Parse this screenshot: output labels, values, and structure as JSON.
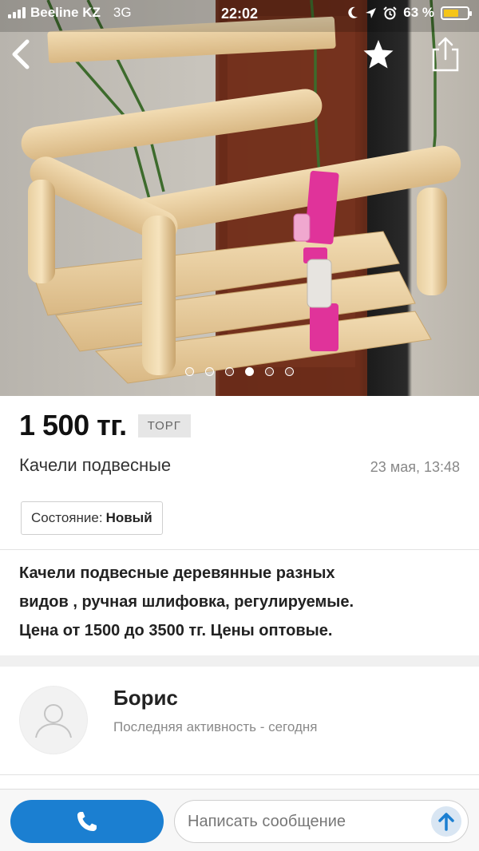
{
  "status_bar": {
    "carrier": "Beeline KZ",
    "network": "3G",
    "time": "22:02",
    "battery_text": "63 %",
    "battery_level": 0.63,
    "battery_color": "#f5c518"
  },
  "nav": {
    "back_icon": "chevron-left-icon",
    "favorite_icon": "star-icon",
    "share_icon": "share-icon"
  },
  "gallery": {
    "photo_count": 6,
    "active_index": 3
  },
  "listing": {
    "price": "1 500 тг.",
    "negotiable_badge": "ТОРГ",
    "title": "Качели подвесные",
    "date": "23 мая, 13:48",
    "condition_label": "Состояние:",
    "condition_value": "Новый",
    "description": "Качели подвесные деревянные   разных\nвидов , ручная шлифовка, регулируемые.\nЦена от 1500 до 3500 тг.  Цены оптовые."
  },
  "seller": {
    "name": "Борис",
    "activity": "Последняя активность - сегодня"
  },
  "actions": {
    "call_icon": "phone-icon",
    "message_placeholder": "Написать сообщение",
    "send_icon": "arrow-up-icon",
    "accent_color": "#1b7fd1"
  }
}
